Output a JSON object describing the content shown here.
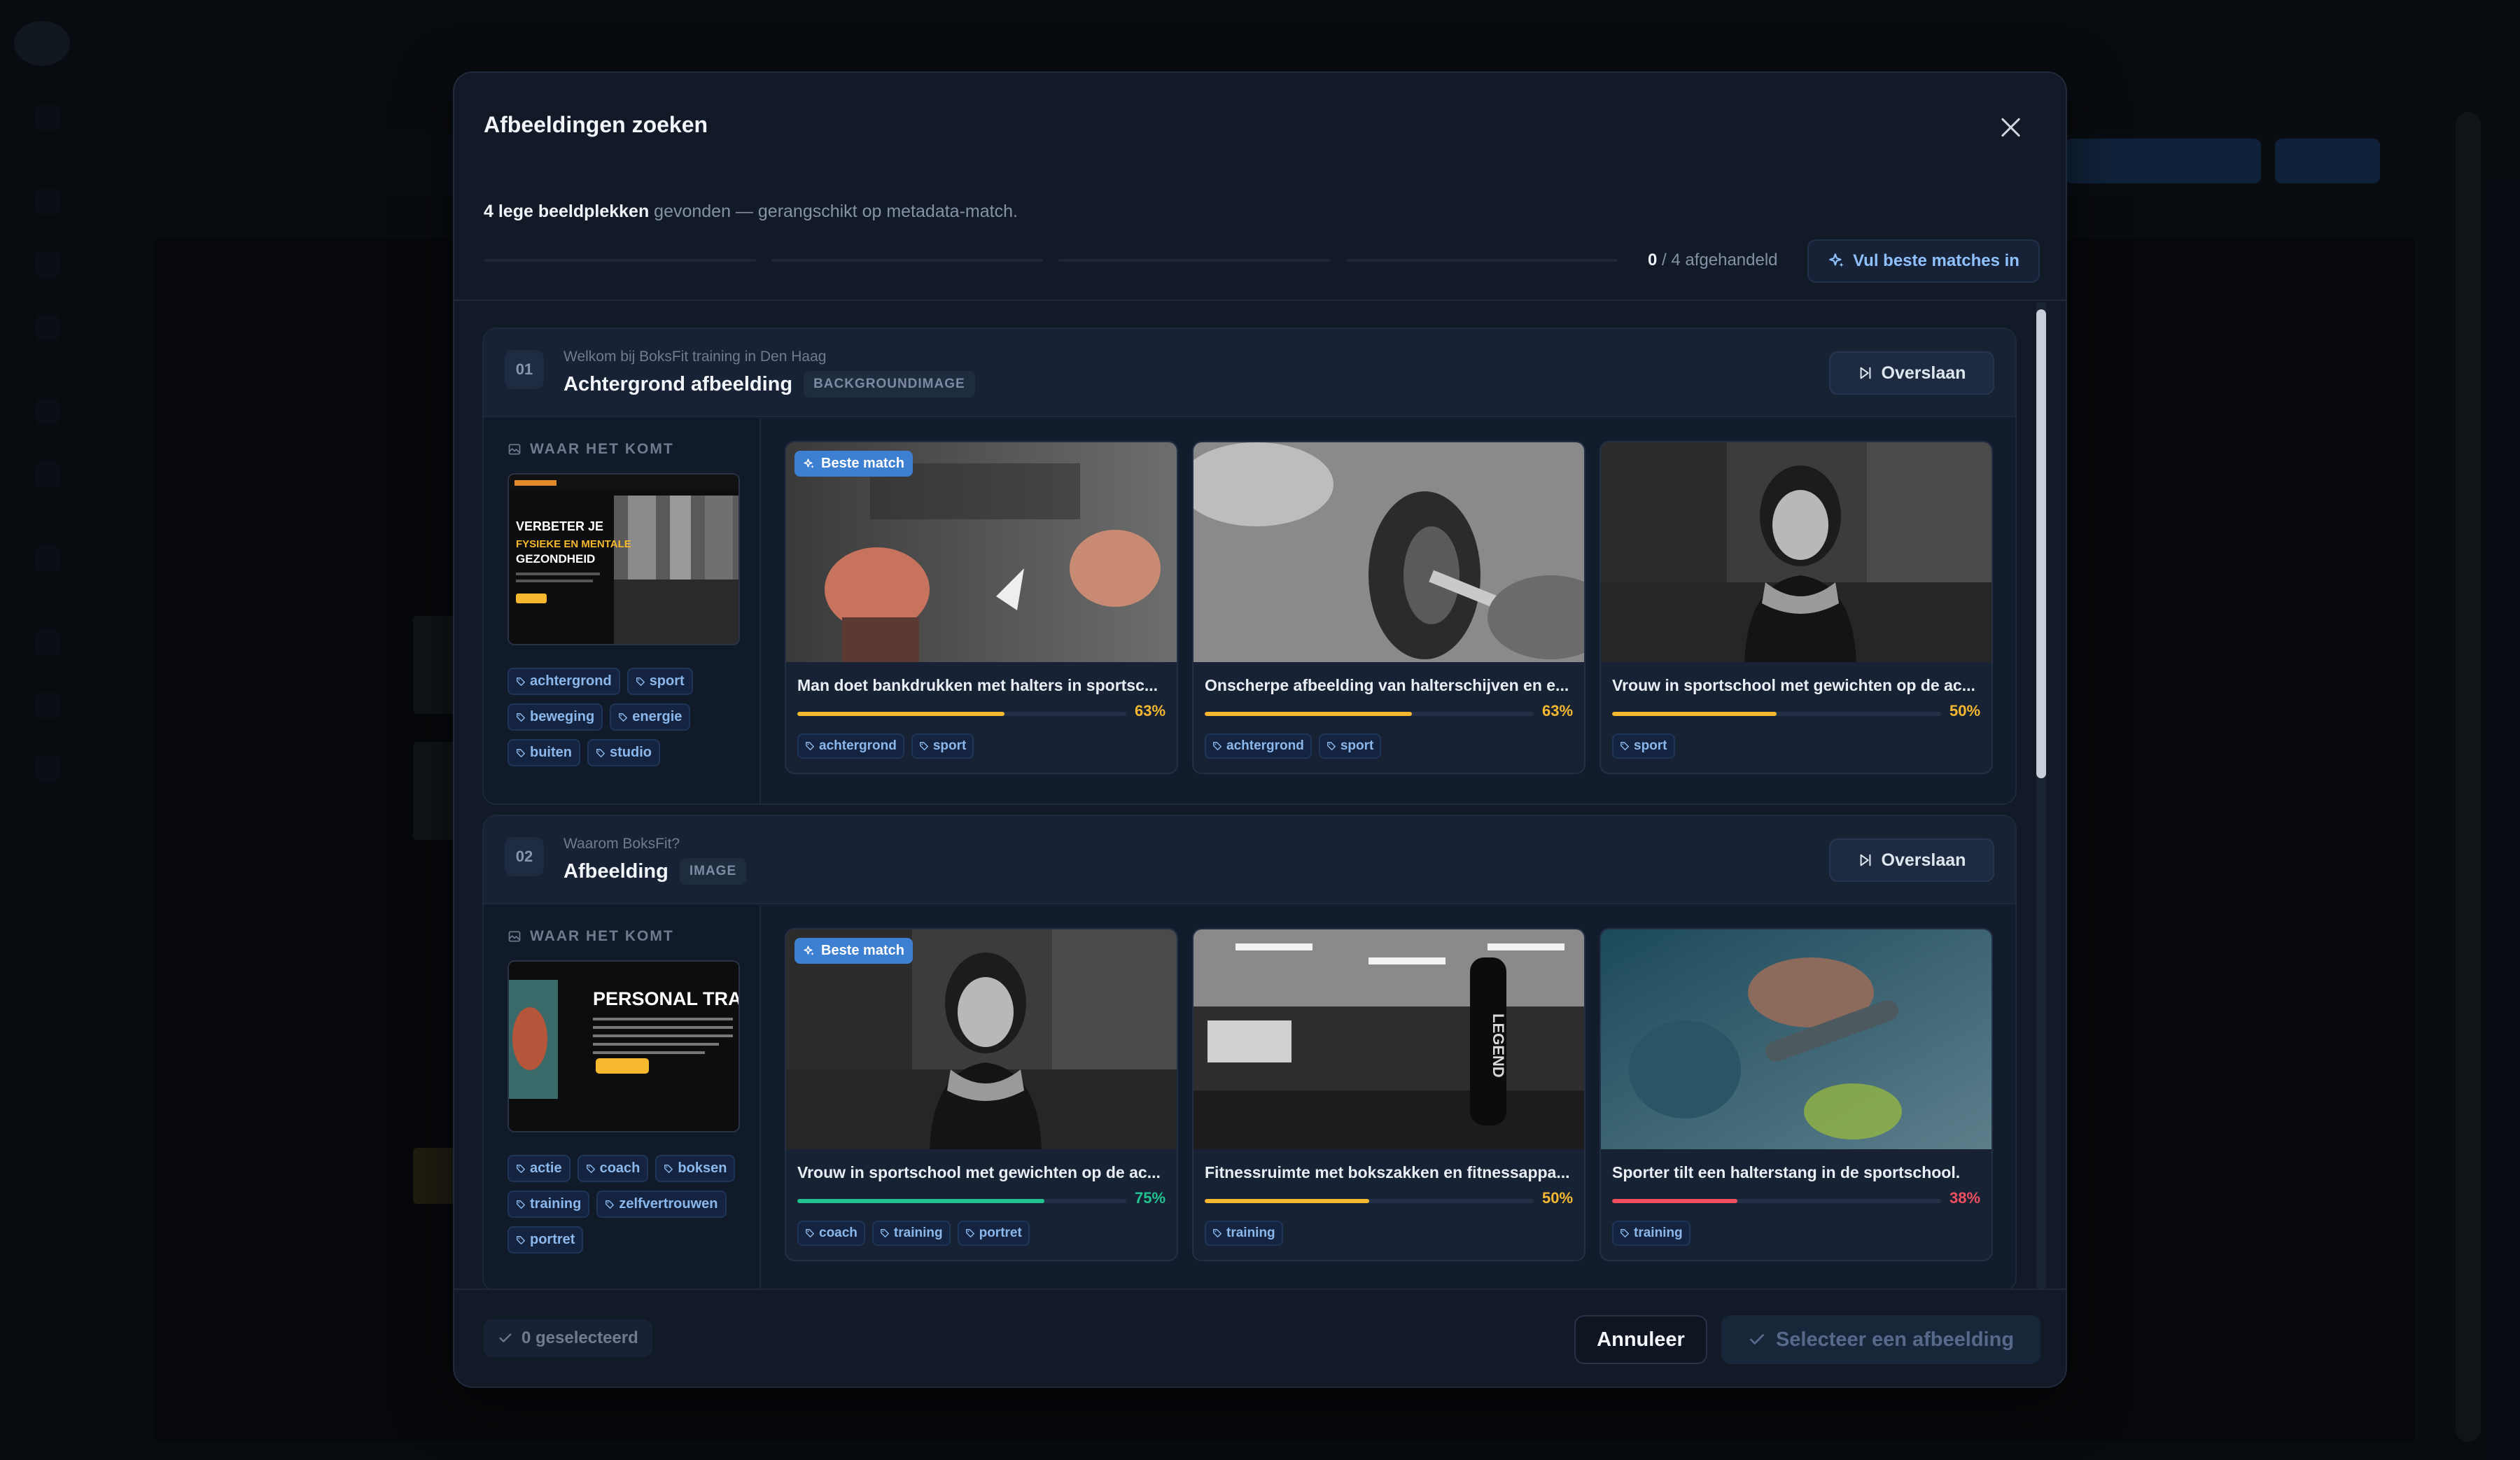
{
  "modal": {
    "title": "Afbeeldingen zoeken",
    "summary_bold": "4 lege beeldplekken",
    "summary_rest": " gevonden — gerangschikt op metadata-match.",
    "counter_done": "0",
    "counter_rest": " / 4 afgehandeld",
    "fill_label": "Vul beste matches in"
  },
  "where_label": "WAAR HET KOMT",
  "skip_label": "Overslaan",
  "best_label": "Beste match",
  "sections": [
    {
      "num": "01",
      "context": "Welkom bij BoksFit training in Den Haag",
      "title": "Achtergrond afbeelding",
      "type": "BACKGROUNDIMAGE",
      "thumb_text": [
        "VERBETER JE",
        "FYSIEKE EN MENTALE",
        "GEZONDHEID"
      ],
      "tags": [
        "achtergrond",
        "sport",
        "beweging",
        "energie",
        "buiten",
        "studio"
      ],
      "cards": [
        {
          "caption": "Man doet bankdrukken met halters in sportsc...",
          "score": 63,
          "tags": [
            "achtergrond",
            "sport"
          ],
          "best": true
        },
        {
          "caption": "Onscherpe afbeelding van halterschijven en e...",
          "score": 63,
          "tags": [
            "achtergrond",
            "sport"
          ],
          "best": false
        },
        {
          "caption": "Vrouw in sportschool met gewichten op de ac...",
          "score": 50,
          "tags": [
            "sport"
          ],
          "best": false
        }
      ]
    },
    {
      "num": "02",
      "context": "Waarom BoksFit?",
      "title": "Afbeelding",
      "type": "IMAGE",
      "thumb_text": [
        "PERSONAL TRAININ"
      ],
      "tags": [
        "actie",
        "coach",
        "boksen",
        "training",
        "zelfvertrouwen",
        "portret"
      ],
      "cards": [
        {
          "caption": "Vrouw in sportschool met gewichten op de ac...",
          "score": 75,
          "tags": [
            "coach",
            "training",
            "portret"
          ],
          "best": true
        },
        {
          "caption": "Fitnessruimte met bokszakken en fitnessappa...",
          "score": 50,
          "tags": [
            "training"
          ],
          "best": false
        },
        {
          "caption": "Sporter tilt een halterstang in de sportschool.",
          "score": 38,
          "tags": [
            "training"
          ],
          "best": false
        }
      ]
    }
  ],
  "footer": {
    "selected": "0 geselecteerd",
    "cancel": "Annuleer",
    "choose": "Selecteer een afbeelding"
  },
  "colors": {
    "accent": "#3d7fd1",
    "score_high": "#22c38e",
    "score_mid": "#f5b82e",
    "score_low": "#ef4f5f"
  }
}
